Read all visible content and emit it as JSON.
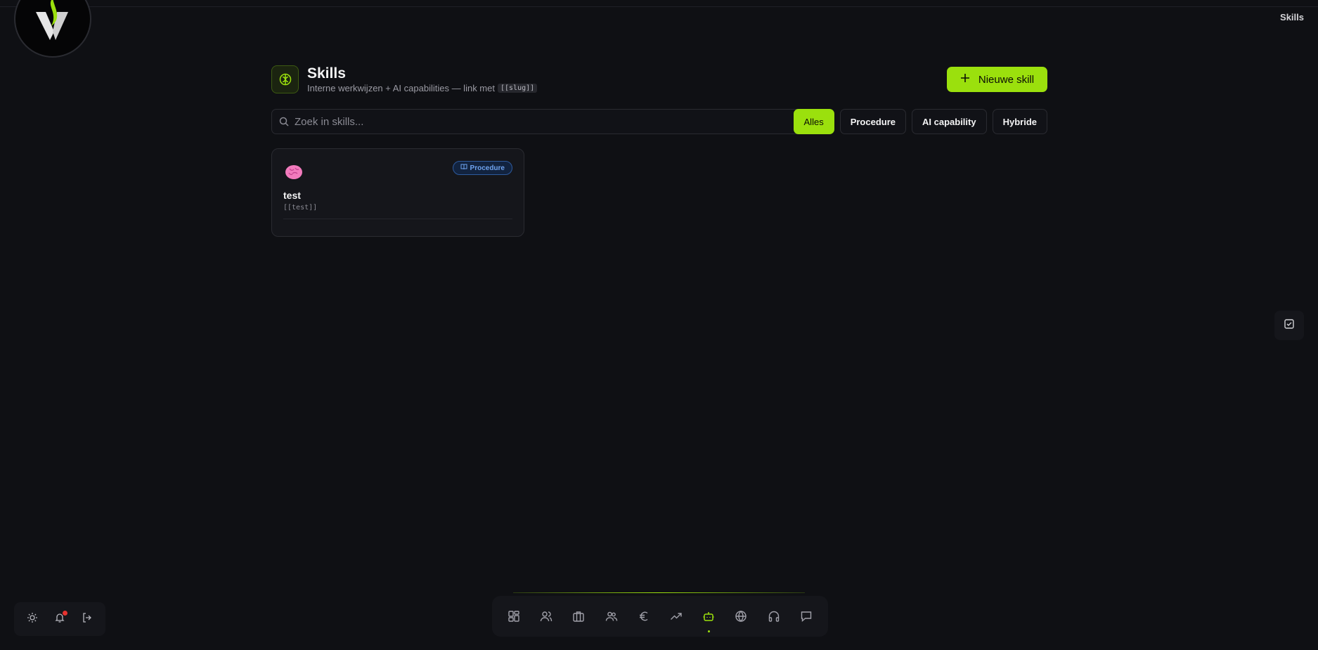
{
  "app": {
    "page_title": "Skills"
  },
  "header": {
    "title": "Skills",
    "subtitle": "Interne werkwijzen + AI capabilities — link met",
    "slug_hint": "[[slug]]",
    "new_button_label": "Nieuwe skill"
  },
  "search": {
    "placeholder": "Zoek in skills..."
  },
  "filters": [
    {
      "label": "Alles",
      "active": true
    },
    {
      "label": "Procedure",
      "active": false
    },
    {
      "label": "AI capability",
      "active": false
    },
    {
      "label": "Hybride",
      "active": false
    }
  ],
  "skills": [
    {
      "icon": "brain-emoji-icon",
      "name": "test",
      "slug": "[[test]]",
      "type_badge": "Procedure"
    }
  ],
  "dock": {
    "items": [
      "dashboard-icon",
      "users-icon",
      "briefcase-icon",
      "team-icon",
      "euro-icon",
      "trending-up-icon",
      "bot-icon",
      "globe-icon",
      "headphones-icon",
      "chat-icon"
    ],
    "active_item": "bot-icon"
  },
  "colors": {
    "accent": "#9be00d",
    "background": "#0f1014",
    "badge_blue": "#6fa3ef",
    "notification": "#e5322f"
  }
}
